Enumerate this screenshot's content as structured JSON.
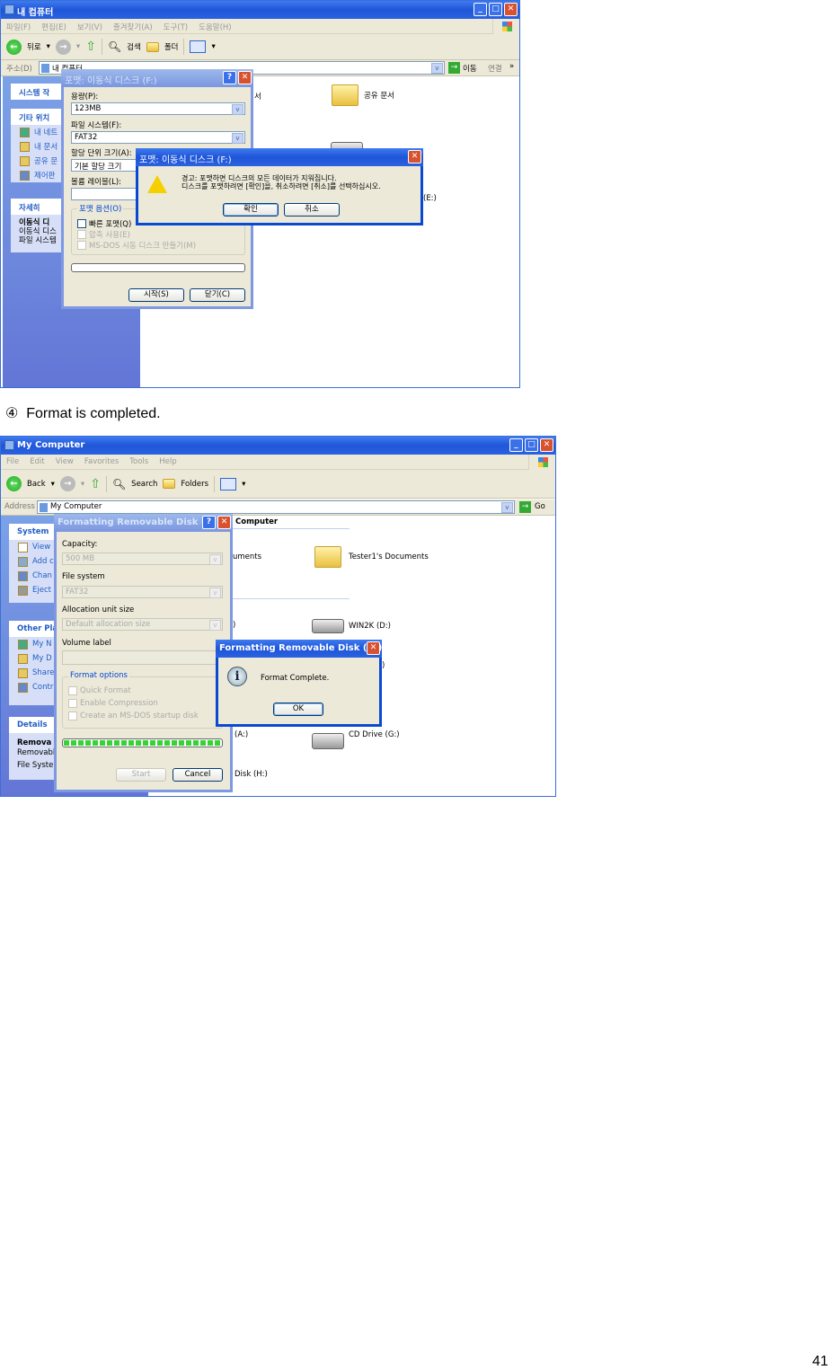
{
  "shot1": {
    "title": "내 컴퓨터",
    "menu": [
      "파일(F)",
      "편집(E)",
      "보기(V)",
      "즐겨찾기(A)",
      "도구(T)",
      "도움말(H)"
    ],
    "toolbar": {
      "back": "뒤로",
      "search": "검색",
      "folders": "폴더"
    },
    "address": {
      "label": "주소(D)",
      "value": "내 컴퓨터",
      "go": "이동",
      "links": "연결",
      "more": "»"
    },
    "left": {
      "system_tasks": "시스템 작",
      "other_places": {
        "title": "기타 위치",
        "items": [
          "내 네트",
          "내 문서",
          "공유 문",
          "제어판"
        ]
      },
      "details": {
        "title": "자세히",
        "lines": [
          "이동식 디",
          "이동식 디스",
          "파일 시스템"
        ]
      }
    },
    "content": {
      "partial1": "서",
      "shared_docs": "공유 문서",
      "drive_e": "(E:)"
    },
    "format_dialog": {
      "title": "포맷: 이동식 디스크 (F:)",
      "capacity_label": "용량(P):",
      "capacity_value": "123MB",
      "fs_label": "파일 시스템(F):",
      "fs_value": "FAT32",
      "alloc_label": "할당 단위 크기(A):",
      "alloc_value": "기본 할당 크기",
      "volume_label": "볼륨 레이블(L):",
      "volume_value": "",
      "options_label": "포맷 옵션(O)",
      "options": [
        "빠른 포맷(Q)",
        "압축 사용(E)",
        "MS-DOS 시동 디스크 만들기(M)"
      ],
      "progress": 0,
      "start": "시작(S)",
      "close": "닫기(C)"
    },
    "warning_dialog": {
      "title": "포맷: 이동식 디스크 (F:)",
      "line1": "경고: 포맷하면 디스크의 모든 데이터가 지워집니다.",
      "line2": "디스크를 포맷하려면 [확인]을, 취소하려면 [취소]를 선택하십시오.",
      "ok": "확인",
      "cancel": "취소"
    }
  },
  "caption": "④  Format is completed.",
  "shot2": {
    "title": "My Computer",
    "menu": [
      "File",
      "Edit",
      "View",
      "Favorites",
      "Tools",
      "Help"
    ],
    "toolbar": {
      "back": "Back",
      "search": "Search",
      "folders": "Folders"
    },
    "address": {
      "label": "Address",
      "value": "My Computer",
      "go": "Go"
    },
    "left": {
      "system": {
        "title": "System",
        "items": [
          "View",
          "Add c",
          "Chan",
          "Eject"
        ]
      },
      "other_places": {
        "title": "Other Pla",
        "items": [
          "My N",
          "My D",
          "Share",
          "Contr"
        ]
      },
      "details": {
        "title": "Details",
        "lines": [
          "Remova",
          "Removabl",
          "File Syste"
        ]
      }
    },
    "content": {
      "header": "Computer",
      "documents_partial": "uments",
      "tester_docs": "Tester1's Documents",
      "paren1": ")",
      "win2k": "WIN2K (D:)",
      "paren2": ")",
      "drive_a": "(A:)",
      "cd_drive": "CD Drive (G:)",
      "disk_h": "Disk (H:)"
    },
    "format_dialog": {
      "title": "Formatting Removable Disk (H:)",
      "capacity_label": "Capacity:",
      "capacity_value": "500 MB",
      "fs_label": "File system",
      "fs_value": "FAT32",
      "alloc_label": "Allocation unit size",
      "alloc_value": "Default allocation size",
      "volume_label": "Volume label",
      "volume_value": "",
      "options_label": "Format options",
      "options": [
        "Quick Format",
        "Enable Compression",
        "Create an MS-DOS startup disk"
      ],
      "progress": 100,
      "start": "Start",
      "cancel": "Cancel"
    },
    "info_dialog": {
      "title": "Formatting Removable Disk (H:)",
      "message": "Format Complete.",
      "ok": "OK"
    }
  },
  "page_number": "41"
}
